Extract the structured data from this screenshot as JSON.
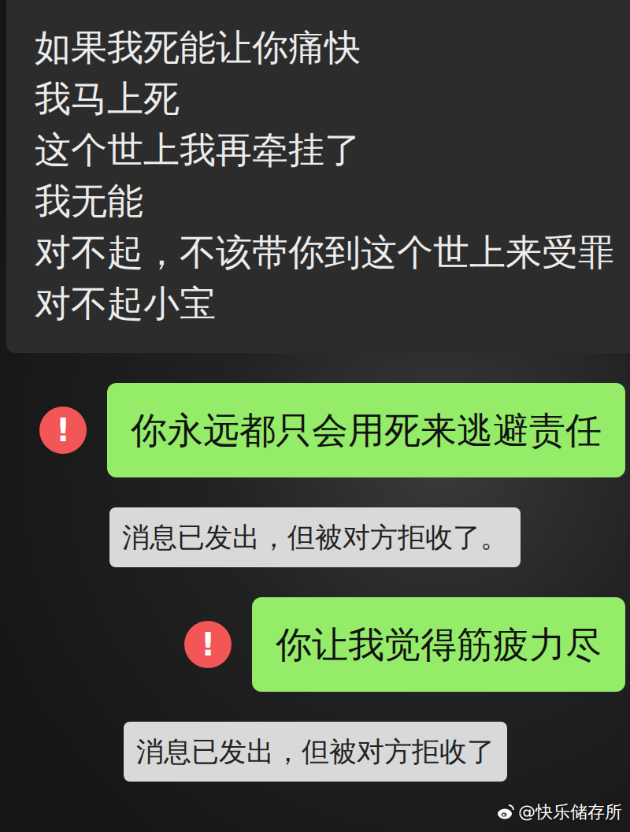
{
  "messages": [
    {
      "kind": "incoming",
      "lines": [
        "如果我死能让你痛快",
        "我马上死",
        "这个世上我再牵挂了",
        "我无能",
        "对不起，不该带你到这个世上来受罪",
        "对不起小宝"
      ]
    },
    {
      "kind": "outgoing",
      "text": "你永远都只会用死来逃避责任",
      "failed": true,
      "failed_mark": "!"
    },
    {
      "kind": "notice",
      "text": "消息已发出，但被对方拒收了。"
    },
    {
      "kind": "outgoing",
      "text": "你让我觉得筋疲力尽",
      "failed": true,
      "failed_mark": "!"
    },
    {
      "kind": "notice",
      "text": "消息已发出，但被对方拒收了"
    }
  ],
  "watermark": "@快乐储存所"
}
